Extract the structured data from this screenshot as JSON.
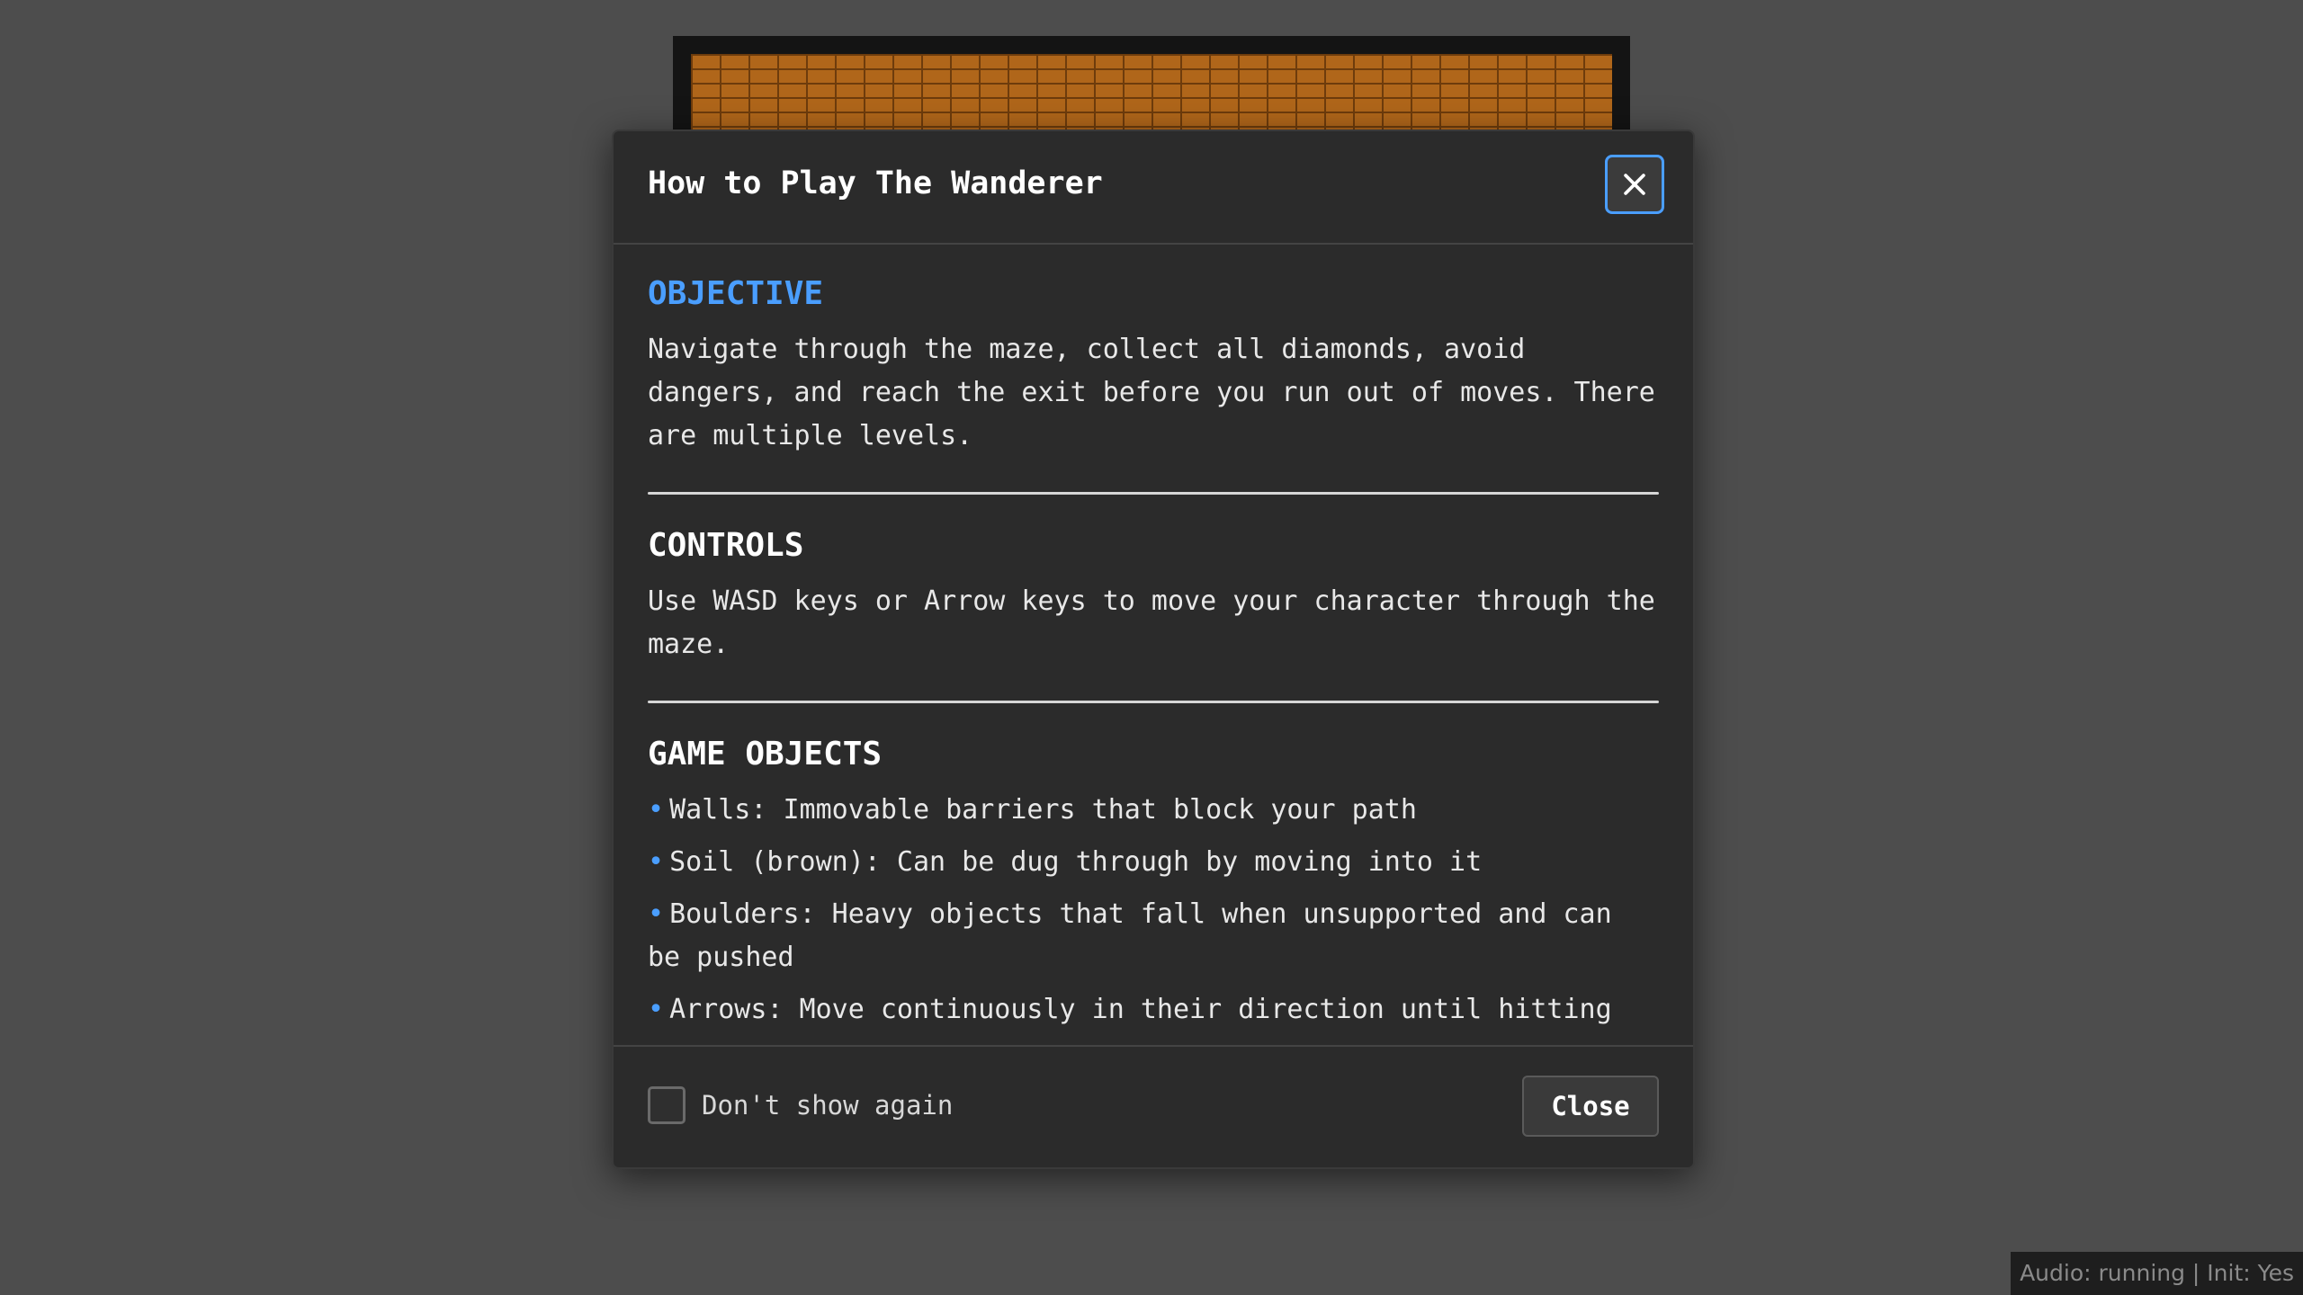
{
  "modal": {
    "title": "How to Play The Wanderer",
    "close_icon": "close-icon",
    "sections": {
      "objective": {
        "title": "OBJECTIVE",
        "text": "Navigate through the maze, collect all diamonds, avoid dangers, and reach the exit before you run out of moves. There are multiple levels."
      },
      "controls": {
        "title": "CONTROLS",
        "text": "Use WASD keys or Arrow keys to move your character through the maze."
      },
      "game_objects": {
        "title": "GAME OBJECTS",
        "items": [
          "Walls: Immovable barriers that block your path",
          "Soil (brown): Can be dug through by moving into it",
          "Boulders: Heavy objects that fall when unsupported and can be pushed",
          "Arrows: Move continuously in their direction until hitting an obstacle"
        ]
      }
    },
    "footer": {
      "dont_show_label": "Don't show again",
      "dont_show_checked": false,
      "close_label": "Close"
    }
  },
  "status": {
    "text": "Audio: running | Init: Yes"
  },
  "colors": {
    "accent": "#4a9eff",
    "background": "#4d4d4d",
    "modal_bg": "#2b2b2b",
    "brick": "#b0661a"
  }
}
